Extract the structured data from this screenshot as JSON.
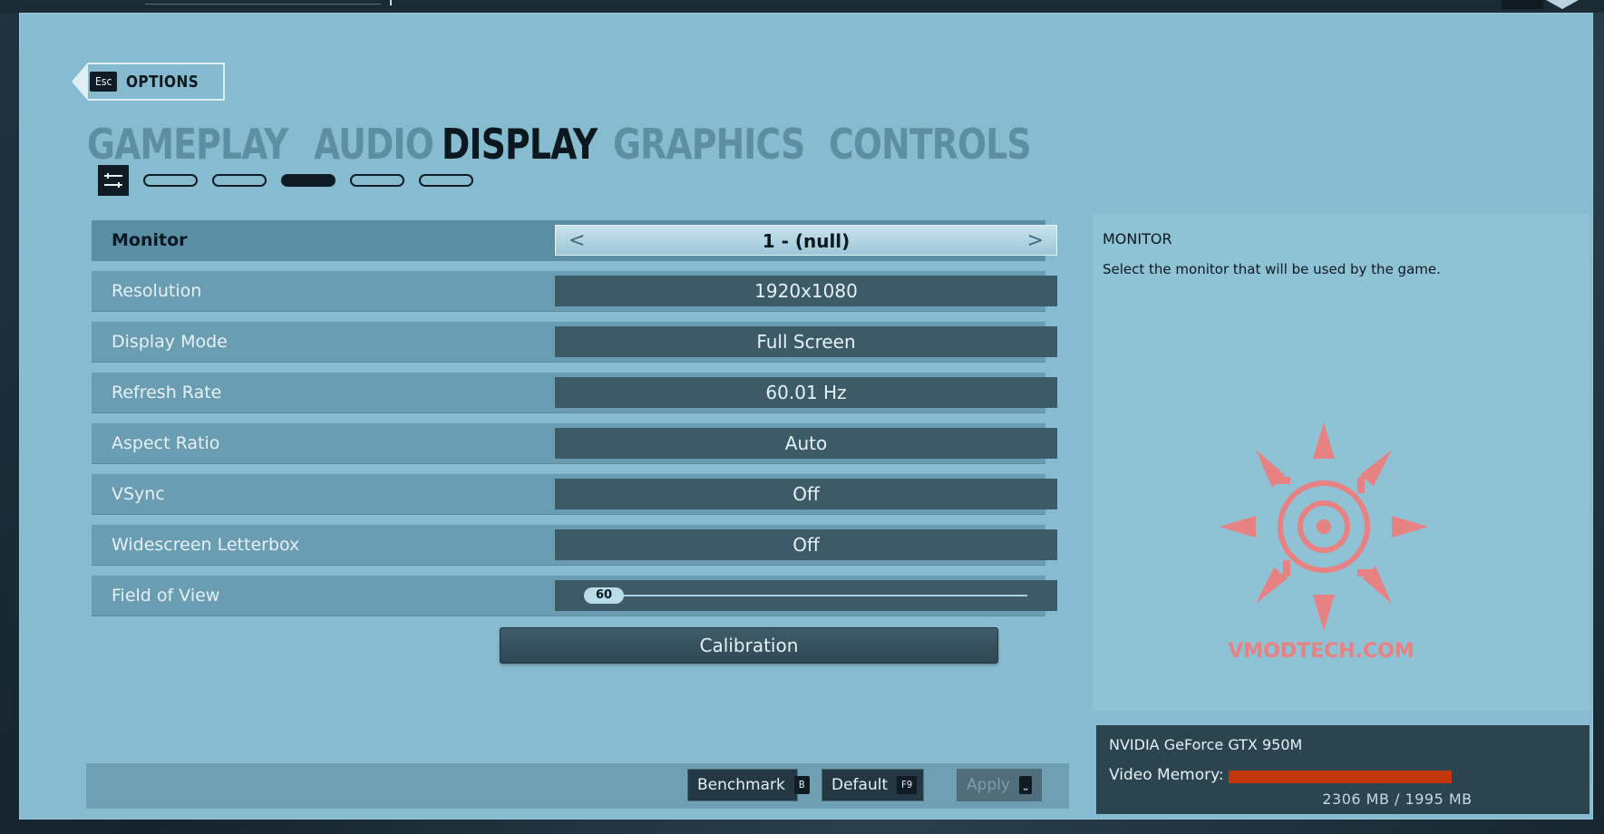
{
  "header": {
    "esc_key": "Esc",
    "back_label": "OPTIONS"
  },
  "tabs": [
    {
      "label": "GAMEPLAY",
      "active": false
    },
    {
      "label": "AUDIO",
      "active": false
    },
    {
      "label": "DISPLAY",
      "active": true
    },
    {
      "label": "GRAPHICS",
      "active": false
    },
    {
      "label": "CONTROLS",
      "active": false
    }
  ],
  "subtabs": {
    "icon": "sliders-icon",
    "count": 5,
    "active_index": 2
  },
  "settings": [
    {
      "label": "Monitor",
      "value": "1 - (null)"
    },
    {
      "label": "Resolution",
      "value": "1920x1080"
    },
    {
      "label": "Display Mode",
      "value": "Full Screen"
    },
    {
      "label": "Refresh Rate",
      "value": "60.01 Hz"
    },
    {
      "label": "Aspect Ratio",
      "value": "Auto"
    },
    {
      "label": "VSync",
      "value": "Off"
    },
    {
      "label": "Widescreen Letterbox",
      "value": "Off"
    },
    {
      "label": "Field of View",
      "value": "60"
    }
  ],
  "calibration_label": "Calibration",
  "bottom_buttons": {
    "benchmark": {
      "label": "Benchmark",
      "key": "B"
    },
    "default": {
      "label": "Default",
      "key": "F9"
    },
    "apply": {
      "label": "Apply",
      "key": "",
      "disabled": true
    }
  },
  "info": {
    "title": "MONITOR",
    "description": "Select the monitor that will be used by the game.",
    "watermark": "VMODTECH.COM"
  },
  "gpu": {
    "name": "NVIDIA GeForce GTX 950M",
    "memory_label": "Video Memory:",
    "memory_value": "2306 MB / 1995 MB"
  },
  "colors": {
    "panel": "#87bbd0",
    "active_text": "#0c1820",
    "inactive_tab": "#5e8ea1",
    "memory_bar": "#c2360a"
  }
}
